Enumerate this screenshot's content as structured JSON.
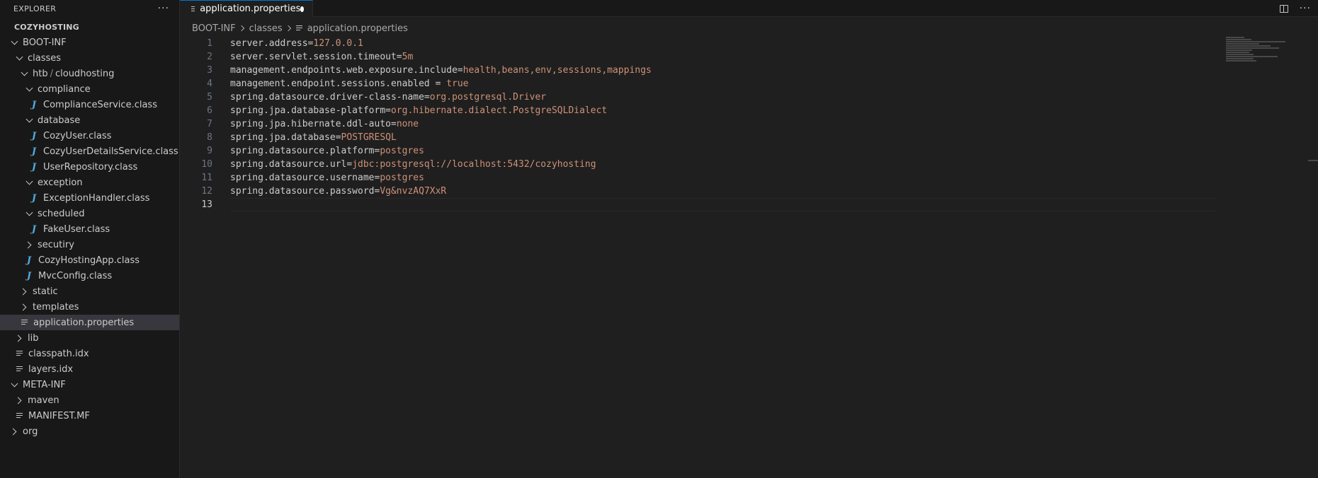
{
  "sidebar": {
    "header": "EXPLORER",
    "more": "···",
    "section": "COZYHOSTING",
    "tree": [
      {
        "label": "BOOT-INF",
        "depth": 0,
        "type": "folder",
        "open": true
      },
      {
        "label": "classes",
        "depth": 1,
        "type": "folder",
        "open": true
      },
      {
        "label": "htb",
        "label2": "cloudhosting",
        "depth": 2,
        "type": "folder",
        "open": true,
        "compact": true
      },
      {
        "label": "compliance",
        "depth": 3,
        "type": "folder",
        "open": true
      },
      {
        "label": "ComplianceService.class",
        "depth": 4,
        "type": "java"
      },
      {
        "label": "database",
        "depth": 3,
        "type": "folder",
        "open": true
      },
      {
        "label": "CozyUser.class",
        "depth": 4,
        "type": "java"
      },
      {
        "label": "CozyUserDetailsService.class",
        "depth": 4,
        "type": "java"
      },
      {
        "label": "UserRepository.class",
        "depth": 4,
        "type": "java"
      },
      {
        "label": "exception",
        "depth": 3,
        "type": "folder",
        "open": true
      },
      {
        "label": "ExceptionHandler.class",
        "depth": 4,
        "type": "java"
      },
      {
        "label": "scheduled",
        "depth": 3,
        "type": "folder",
        "open": true
      },
      {
        "label": "FakeUser.class",
        "depth": 4,
        "type": "java"
      },
      {
        "label": "secutiry",
        "depth": 3,
        "type": "folder",
        "open": false
      },
      {
        "label": "CozyHostingApp.class",
        "depth": 3,
        "type": "java"
      },
      {
        "label": "MvcConfig.class",
        "depth": 3,
        "type": "java"
      },
      {
        "label": "static",
        "depth": 2,
        "type": "folder",
        "open": false
      },
      {
        "label": "templates",
        "depth": 2,
        "type": "folder",
        "open": false
      },
      {
        "label": "application.properties",
        "depth": 2,
        "type": "file",
        "selected": true
      },
      {
        "label": "lib",
        "depth": 1,
        "type": "folder",
        "open": false
      },
      {
        "label": "classpath.idx",
        "depth": 1,
        "type": "file"
      },
      {
        "label": "layers.idx",
        "depth": 1,
        "type": "file"
      },
      {
        "label": "META-INF",
        "depth": 0,
        "type": "folder",
        "open": true
      },
      {
        "label": "maven",
        "depth": 1,
        "type": "folder",
        "open": false
      },
      {
        "label": "MANIFEST.MF",
        "depth": 1,
        "type": "file"
      },
      {
        "label": "org",
        "depth": 0,
        "type": "folder",
        "open": false
      }
    ]
  },
  "tab": {
    "label": "application.properties",
    "dirty": true
  },
  "tab_actions": {
    "more": "···"
  },
  "breadcrumb": [
    "BOOT-INF",
    "classes",
    "application.properties"
  ],
  "editor": {
    "active_line": 13,
    "lines": [
      {
        "num": "1",
        "key": "server.address=",
        "value": "127.0.0.1"
      },
      {
        "num": "2",
        "key": "server.servlet.session.timeout=",
        "value": "5m"
      },
      {
        "num": "3",
        "key": "management.endpoints.web.exposure.include=",
        "value": "health,beans,env,sessions,mappings"
      },
      {
        "num": "4",
        "key": "management.endpoint.sessions.enabled = ",
        "value": "true"
      },
      {
        "num": "5",
        "key": "spring.datasource.driver-class-name=",
        "value": "org.postgresql.Driver"
      },
      {
        "num": "6",
        "key": "spring.jpa.database-platform=",
        "value": "org.hibernate.dialect.PostgreSQLDialect"
      },
      {
        "num": "7",
        "key": "spring.jpa.hibernate.ddl-auto=",
        "value": "none"
      },
      {
        "num": "8",
        "key": "spring.jpa.database=",
        "value": "POSTGRESQL"
      },
      {
        "num": "9",
        "key": "spring.datasource.platform=",
        "value": "postgres"
      },
      {
        "num": "10",
        "key": "spring.datasource.url=",
        "value": "jdbc:postgresql://localhost:5432/cozyhosting"
      },
      {
        "num": "11",
        "key": "spring.datasource.username=",
        "value": "postgres"
      },
      {
        "num": "12",
        "key": "spring.datasource.password=",
        "value": "Vg&nvzAQ7XxR"
      },
      {
        "num": "13",
        "key": "",
        "value": ""
      }
    ]
  },
  "colors": {
    "key": "#cccccc",
    "value": "#ce9178",
    "accent": "#0078d4",
    "java_icon": "#52a9e1"
  }
}
